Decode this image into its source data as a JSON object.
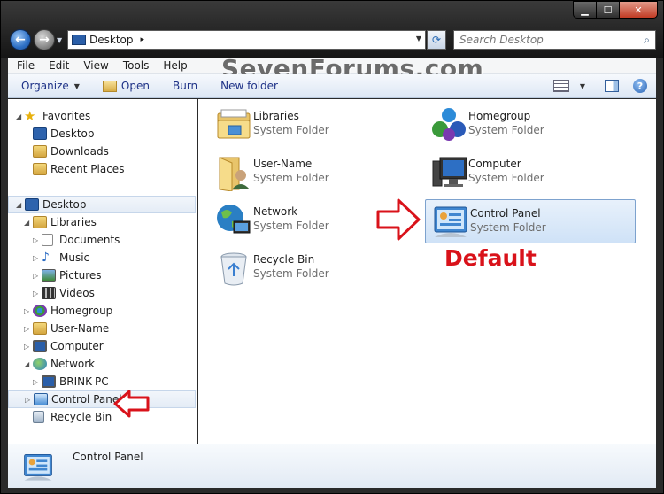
{
  "window": {
    "caption_minimize": "▁",
    "caption_maximize": "☐",
    "caption_close": "✕"
  },
  "address": {
    "location": "Desktop",
    "separator": "▸"
  },
  "search": {
    "placeholder": "Search Desktop"
  },
  "menubar": {
    "items": [
      "File",
      "Edit",
      "View",
      "Tools",
      "Help"
    ]
  },
  "watermark": "SevenForums.com",
  "toolbar": {
    "organize": "Organize",
    "open": "Open",
    "burn": "Burn",
    "new_folder": "New folder"
  },
  "navpane": {
    "favorites": "Favorites",
    "favorites_items": [
      "Desktop",
      "Downloads",
      "Recent Places"
    ],
    "desktop": "Desktop",
    "libraries": "Libraries",
    "libraries_items": [
      "Documents",
      "Music",
      "Pictures",
      "Videos"
    ],
    "homegroup": "Homegroup",
    "user_name": "User-Name",
    "computer": "Computer",
    "network": "Network",
    "network_items": [
      "BRINK-PC"
    ],
    "control_panel": "Control Panel",
    "recycle_bin": "Recycle Bin"
  },
  "content": {
    "items": [
      {
        "name": "Libraries",
        "type": "System Folder",
        "icon": "libraries-icon"
      },
      {
        "name": "Homegroup",
        "type": "System Folder",
        "icon": "homegroup-icon"
      },
      {
        "name": "User-Name",
        "type": "System Folder",
        "icon": "user-folder-icon"
      },
      {
        "name": "Computer",
        "type": "System Folder",
        "icon": "computer-icon"
      },
      {
        "name": "Network",
        "type": "System Folder",
        "icon": "network-icon"
      },
      {
        "name": "Control Panel",
        "type": "System Folder",
        "icon": "control-panel-icon"
      },
      {
        "name": "Recycle Bin",
        "type": "System Folder",
        "icon": "recycle-bin-icon"
      }
    ]
  },
  "annotation": "Default",
  "details": {
    "name": "Control Panel"
  },
  "colors": {
    "annotation_red": "#d9121a",
    "selection_blue": "#cfe2f7"
  }
}
